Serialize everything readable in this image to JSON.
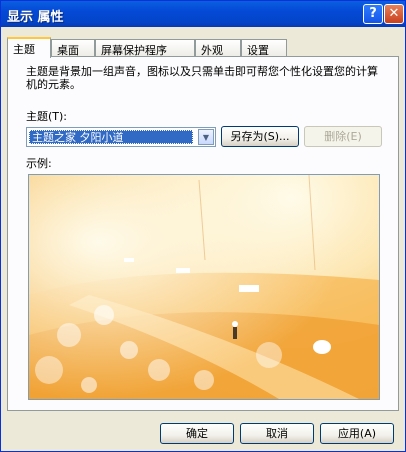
{
  "window": {
    "title": "显示 属性",
    "help": "?",
    "close": "✕"
  },
  "tabs": [
    "主题",
    "桌面",
    "屏幕保护程序",
    "外观",
    "设置"
  ],
  "panel": {
    "description": "主题是背景加一组声音，图标以及只需单击即可帮您个性化设置您的计算机的元素。",
    "theme_label": "主题(T):",
    "theme_value": "主题之家 夕阳小道",
    "save_as": "另存为(S)...",
    "delete": "删除(E)",
    "sample_label": "示例:"
  },
  "footer": {
    "ok": "确定",
    "cancel": "取消",
    "apply": "应用(A)"
  }
}
